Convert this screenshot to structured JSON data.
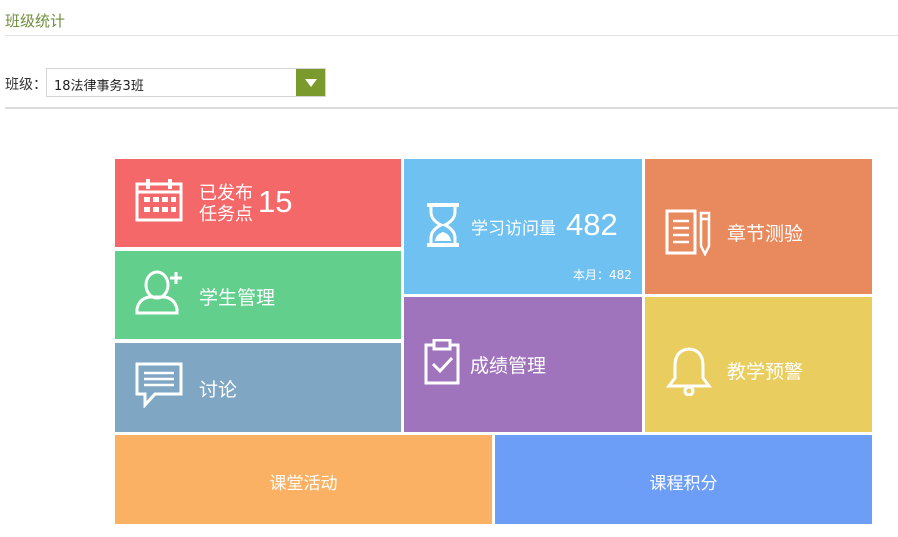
{
  "page": {
    "title": "班级统计"
  },
  "filter": {
    "label": "班级：",
    "selected": "18法律事务3班"
  },
  "tiles": {
    "tasks": {
      "line1": "已发布",
      "line2": "任务点",
      "value": "15",
      "color": "#f5686a"
    },
    "visits": {
      "label": "学习访问量",
      "value": "482",
      "month_note": "本月：482",
      "color": "#6fc1f1"
    },
    "quiz": {
      "label": "章节测验",
      "color": "#e98a5e"
    },
    "students": {
      "label": "学生管理",
      "color": "#62cf8d"
    },
    "grades": {
      "label": "成绩管理",
      "color": "#a073bd"
    },
    "warning": {
      "label": "教学预警",
      "color": "#e9cd5f"
    },
    "discussion": {
      "label": "讨论",
      "color": "#7fa6c3"
    },
    "activity": {
      "label": "课堂活动",
      "color": "#fab163"
    },
    "points": {
      "label": "课程积分",
      "color": "#6c9df7"
    }
  },
  "icons": {
    "tasks": "calendar-icon",
    "visits": "hourglass-icon",
    "quiz": "document-pencil-icon",
    "students": "add-user-icon",
    "grades": "clipboard-check-icon",
    "warning": "bell-icon",
    "discussion": "chat-icon"
  }
}
